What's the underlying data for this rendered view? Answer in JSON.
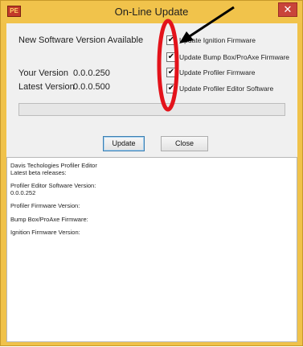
{
  "window": {
    "title": "On-Line Update",
    "app_icon_text": "PE",
    "close_glyph": "✕"
  },
  "main": {
    "new_version_label": "New Software Version Available",
    "your_version_label": "Your Version",
    "your_version_value": "0.0.0.250",
    "latest_version_label": "Latest Version",
    "latest_version_value": "0.0.0.500",
    "progress": 0
  },
  "checkboxes": [
    {
      "label": "Update Ignition Firmware",
      "checked": true
    },
    {
      "label": "Update Bump Box/ProAxe Firmware",
      "checked": true
    },
    {
      "label": "Update Profiler Firmware",
      "checked": true
    },
    {
      "label": "Update Profiler Editor Software",
      "checked": true
    }
  ],
  "buttons": {
    "update": "Update",
    "close": "Close"
  },
  "log": {
    "title_line": "Davis Techologies Profiler Editor",
    "subtitle_line": "Latest beta releases:",
    "editor_version_label": "Profiler Editor Software Version:",
    "editor_version_value": "0.0.0.252",
    "profiler_fw_label": "Profiler Firmware Version:",
    "bumpbox_fw_label": "Bump Box/ProAxe Firmware:",
    "ignition_fw_label": "Ignition Firmware Version:"
  },
  "colors": {
    "title_bar": "#f1c34b",
    "annotation_red": "#e3131b",
    "annotation_arrow": "#000000"
  }
}
